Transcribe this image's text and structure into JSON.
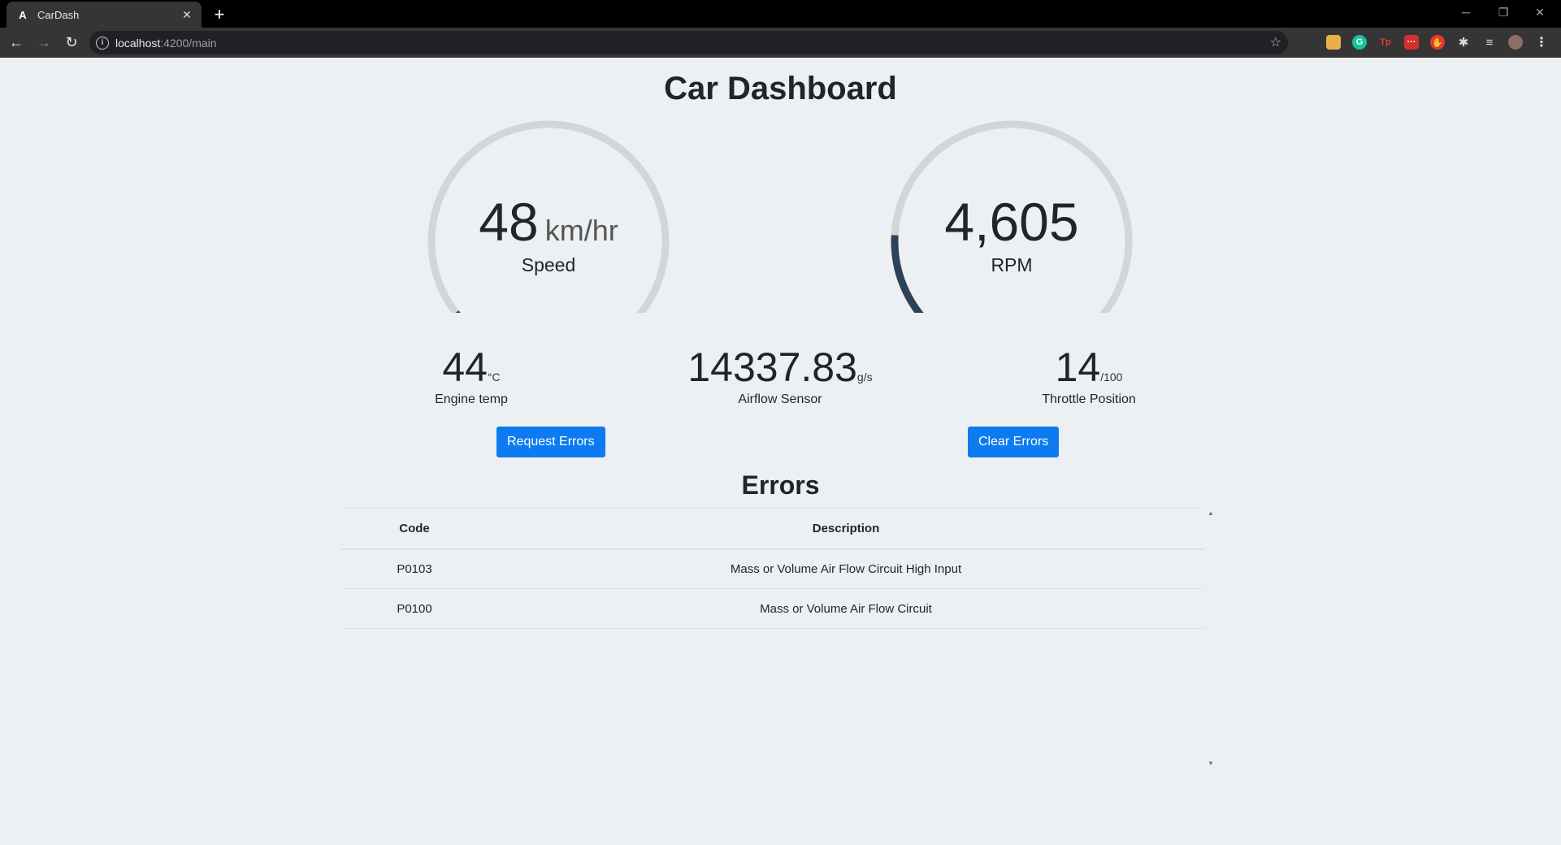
{
  "browser": {
    "tab_title": "CarDash",
    "tab_favicon": "A",
    "url_host": "localhost",
    "url_path": ":4200/main",
    "window_controls": [
      "─",
      "❐",
      "✕"
    ]
  },
  "page": {
    "title": "Car Dashboard"
  },
  "gauges": {
    "speed": {
      "value": "48",
      "unit": "km/hr",
      "label": "Speed",
      "fraction": 0.06
    },
    "rpm": {
      "value": "4,605",
      "label": "RPM",
      "fraction": 0.2
    }
  },
  "stats": {
    "engine_temp": {
      "value": "44",
      "unit": "°C",
      "label": "Engine temp"
    },
    "airflow": {
      "value": "14337.83",
      "unit": "g/s",
      "label": "Airflow Sensor"
    },
    "throttle": {
      "value": "14",
      "unit": "/100",
      "label": "Throttle Position"
    }
  },
  "buttons": {
    "request_errors": "Request Errors",
    "clear_errors": "Clear Errors"
  },
  "errors": {
    "title": "Errors",
    "columns": [
      "Code",
      "Description"
    ],
    "rows": [
      {
        "code": "P0103",
        "description": "Mass or Volume Air Flow Circuit High Input"
      },
      {
        "code": "P0100",
        "description": "Mass or Volume Air Flow Circuit"
      }
    ]
  },
  "colors": {
    "accent": "#0d7bf0",
    "gauge_fill": "#2d4257",
    "gauge_track": "#d3d6d8"
  }
}
